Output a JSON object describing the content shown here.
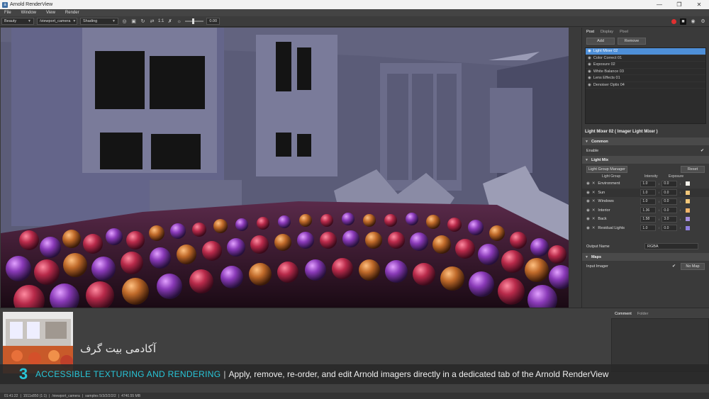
{
  "window": {
    "title": "Arnold RenderView",
    "icon_letter": "a"
  },
  "menu": {
    "items": [
      "File",
      "Window",
      "View",
      "Render"
    ]
  },
  "toolbar": {
    "aov": "Beauty",
    "camera": "/viewport_camera",
    "shading": "Shading",
    "zoom": "1:1",
    "exposure": "0.00"
  },
  "panel": {
    "tabs": [
      "Post",
      "Display",
      "Pixel"
    ],
    "add_label": "Add",
    "remove_label": "Remove",
    "imagers": [
      "Light Mixer 02",
      "Color Correct 01",
      "Exposure 02",
      "White Balance 03",
      "Lens Effects 01",
      "Denoiser Optix 04"
    ],
    "selected_title": "Light Mixer 02  ( Imager Light Mixer )",
    "common_label": "Common",
    "enable_label": "Enable",
    "light_mix_label": "Light Mix",
    "lgm_label": "Light Group Manager",
    "reset_label": "Reset",
    "columns": {
      "group": "Light Group",
      "intensity": "Intensity",
      "exposure": "Exposure"
    },
    "light_groups": [
      {
        "name": "Environment",
        "intensity": "1.0",
        "exposure": "0.0",
        "color": "#f4f1ea"
      },
      {
        "name": "Sun",
        "intensity": "1.0",
        "exposure": "0.0",
        "color": "#f2c77a"
      },
      {
        "name": "Windows",
        "intensity": "1.0",
        "exposure": "0.0",
        "color": "#f2c77a"
      },
      {
        "name": "Interior",
        "intensity": "1.36",
        "exposure": "0.0",
        "color": "#f2b56a"
      },
      {
        "name": "Back",
        "intensity": "1.58",
        "exposure": "3.0",
        "color": "#a68fe0"
      },
      {
        "name": "Residual Lights",
        "intensity": "1.0",
        "exposure": "0.0",
        "color": "#8f7fe0"
      }
    ],
    "output_name_label": "Output Name",
    "output_name_value": "RGBA",
    "maps_label": "Maps",
    "input_imager_label": "Input Imager",
    "no_map_label": "No Map"
  },
  "bottom": {
    "tabs": [
      "Comment",
      "Folder"
    ]
  },
  "overlay": {
    "watermark": "آکادمی بیت گرف",
    "logo_char": "3",
    "banner_title": "ACCESSIBLE TEXTURING AND RENDERING",
    "banner_sep": "|",
    "banner_desc": "Apply, remove, re-order, and edit Arnold imagers directly in a dedicated tab of the Arnold RenderView"
  },
  "status": {
    "time": "01:41:22",
    "resolution": "1511x850 (1:1)",
    "camera": "/viewport_camera",
    "samples": "samples 5/3/2/2/2/2",
    "memory": "4740.55 MB"
  },
  "colors": {
    "accent": "#4e8fd8",
    "banner_title": "#28c6d8",
    "rec": "#e03030"
  }
}
